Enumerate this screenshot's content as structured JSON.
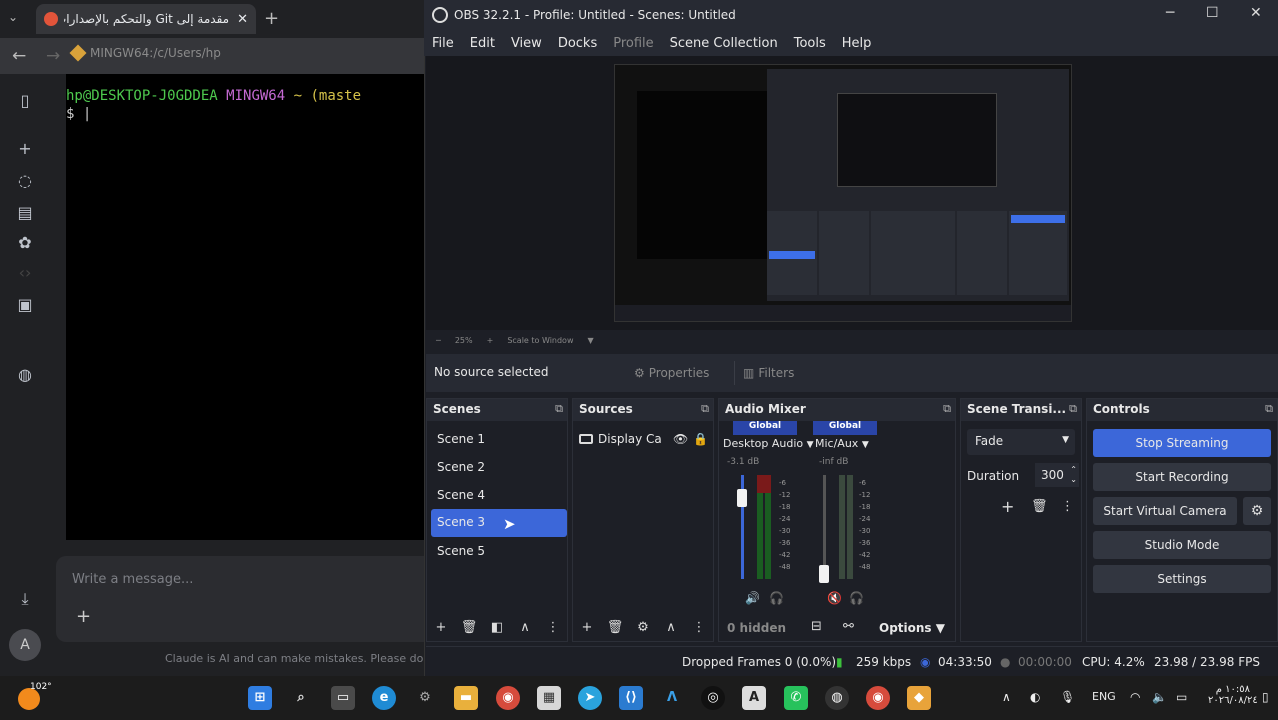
{
  "browser": {
    "tab_title": "مقدمة إلى Git والتحكم بالإصدارات",
    "tab_close": "✕",
    "tab_new": "+",
    "tab_menu": "⌄",
    "address": "MINGW64:/c/Users/hp",
    "terminal": {
      "user_host": "hp@DESKTOP-J0GDDEA",
      "system": "MINGW64",
      "path": "~ (maste",
      "prompt": "$"
    },
    "message_placeholder": "Write a message...",
    "footnote": "Claude is AI and can make mistakes. Please double-check responses.",
    "avatar_letter": "A"
  },
  "obs": {
    "title": "OBS 32.2.1 - Profile: Untitled - Scenes: Untitled",
    "menu": [
      "File",
      "Edit",
      "View",
      "Docks",
      "Profile",
      "Scene Collection",
      "Tools",
      "Help"
    ],
    "preview_toolbar": {
      "zoom": "25%",
      "scale": "Scale to Window"
    },
    "no_source": "No source selected",
    "properties": "Properties",
    "filters": "Filters",
    "scenes": {
      "title": "Scenes",
      "items": [
        "Scene 1",
        "Scene 2",
        "Scene 4",
        "Scene 3",
        "Scene 5"
      ],
      "selected": "Scene 3"
    },
    "sources": {
      "title": "Sources",
      "items": [
        "Display Ca"
      ]
    },
    "audio_mixer": {
      "title": "Audio Mixer",
      "channels": [
        {
          "scope": "Global",
          "name": "Desktop Audio",
          "db": "-3.1 dB",
          "level": 0.85
        },
        {
          "scope": "Global",
          "name": "Mic/Aux",
          "db": "-inf dB",
          "level": 0.1
        }
      ],
      "ticks": [
        "-6",
        "-12",
        "-18",
        "-24",
        "-30",
        "-36",
        "-42",
        "-48"
      ],
      "hidden": "0 hidden",
      "options": "Options"
    },
    "transitions": {
      "title": "Scene Transi...",
      "type": "Fade",
      "duration_label": "Duration",
      "duration_value": "300"
    },
    "controls": {
      "title": "Controls",
      "buttons": [
        "Stop Streaming",
        "Start Recording",
        "Start Virtual Camera",
        "Studio Mode",
        "Settings"
      ]
    },
    "status": {
      "dropped_frames": "Dropped Frames 0 (0.0%)",
      "kbps": "259 kbps",
      "stream_time": "04:33:50",
      "rec_time": "00:00:00",
      "cpu": "CPU: 4.2%",
      "fps": "23.98 / 23.98 FPS"
    }
  },
  "taskbar": {
    "temperature": "102°",
    "language": "ENG",
    "time": "١٠:٥٨ م",
    "date": "٢٠٢٦/٠٨/٢٤"
  }
}
